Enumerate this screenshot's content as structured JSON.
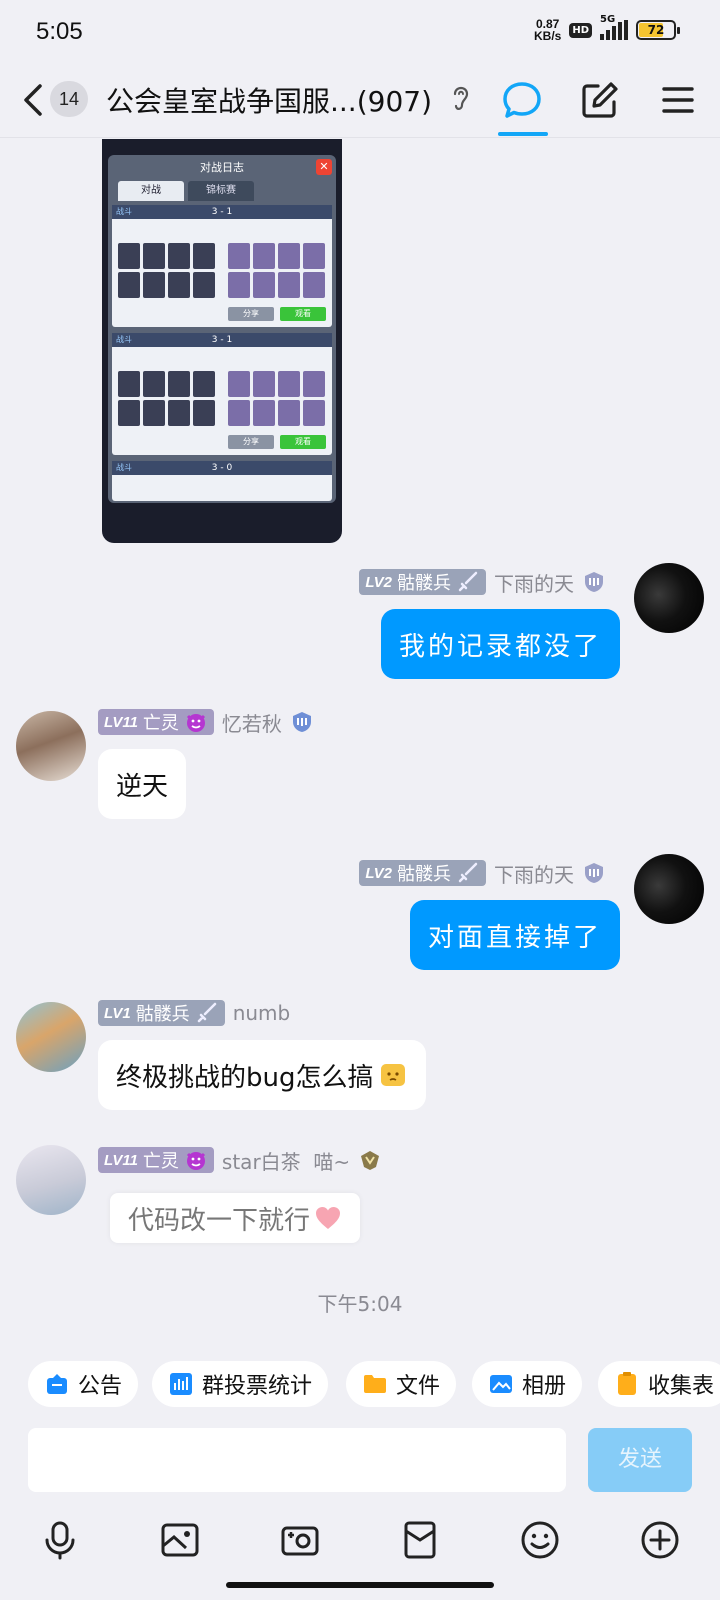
{
  "status_bar": {
    "time": "5:05",
    "net_speed_value": "0.87",
    "net_speed_unit": "KB/s",
    "hd_badge": "HD",
    "network": "5G",
    "battery": "72"
  },
  "header": {
    "unread_count": "14",
    "title": "公会皇室战争国服...(907)"
  },
  "game_screenshot": {
    "panel_title": "对战日志",
    "tabs": [
      "对战",
      "锦标赛"
    ],
    "matches": [
      {
        "tag": "战斗",
        "score": "3 - 1",
        "btn_left": "分享",
        "btn_right": "观看"
      },
      {
        "tag": "战斗",
        "score": "3 - 1",
        "btn_left": "分享",
        "btn_right": "观看"
      },
      {
        "tag": "战斗",
        "score": "3 - 0"
      }
    ]
  },
  "messages": [
    {
      "direction": "out",
      "level": "LV2",
      "title": "骷髅兵",
      "nick": "下雨的天",
      "text": "我的记录都没了"
    },
    {
      "direction": "in",
      "level": "LV11",
      "title": "亡灵",
      "nick": "忆若秋",
      "text": "逆天"
    },
    {
      "direction": "out",
      "level": "LV2",
      "title": "骷髅兵",
      "nick": "下雨的天",
      "text": "对面直接掉了"
    },
    {
      "direction": "in",
      "level": "LV1",
      "title": "骷髅兵",
      "nick": "numb",
      "text": "终极挑战的bug怎么搞"
    },
    {
      "direction": "in",
      "level": "LV11",
      "title": "亡灵",
      "nick": "star白茶  喵~",
      "text": "代码改一下就行"
    }
  ],
  "timestamp": "下午5:04",
  "tools": [
    "公告",
    "群投票统计",
    "文件",
    "相册",
    "收集表"
  ],
  "input": {
    "placeholder": "",
    "send_label": "发送"
  },
  "colors": {
    "accent": "#0099ff",
    "send_disabled": "#86ccf7",
    "background": "#f0f0f5"
  }
}
